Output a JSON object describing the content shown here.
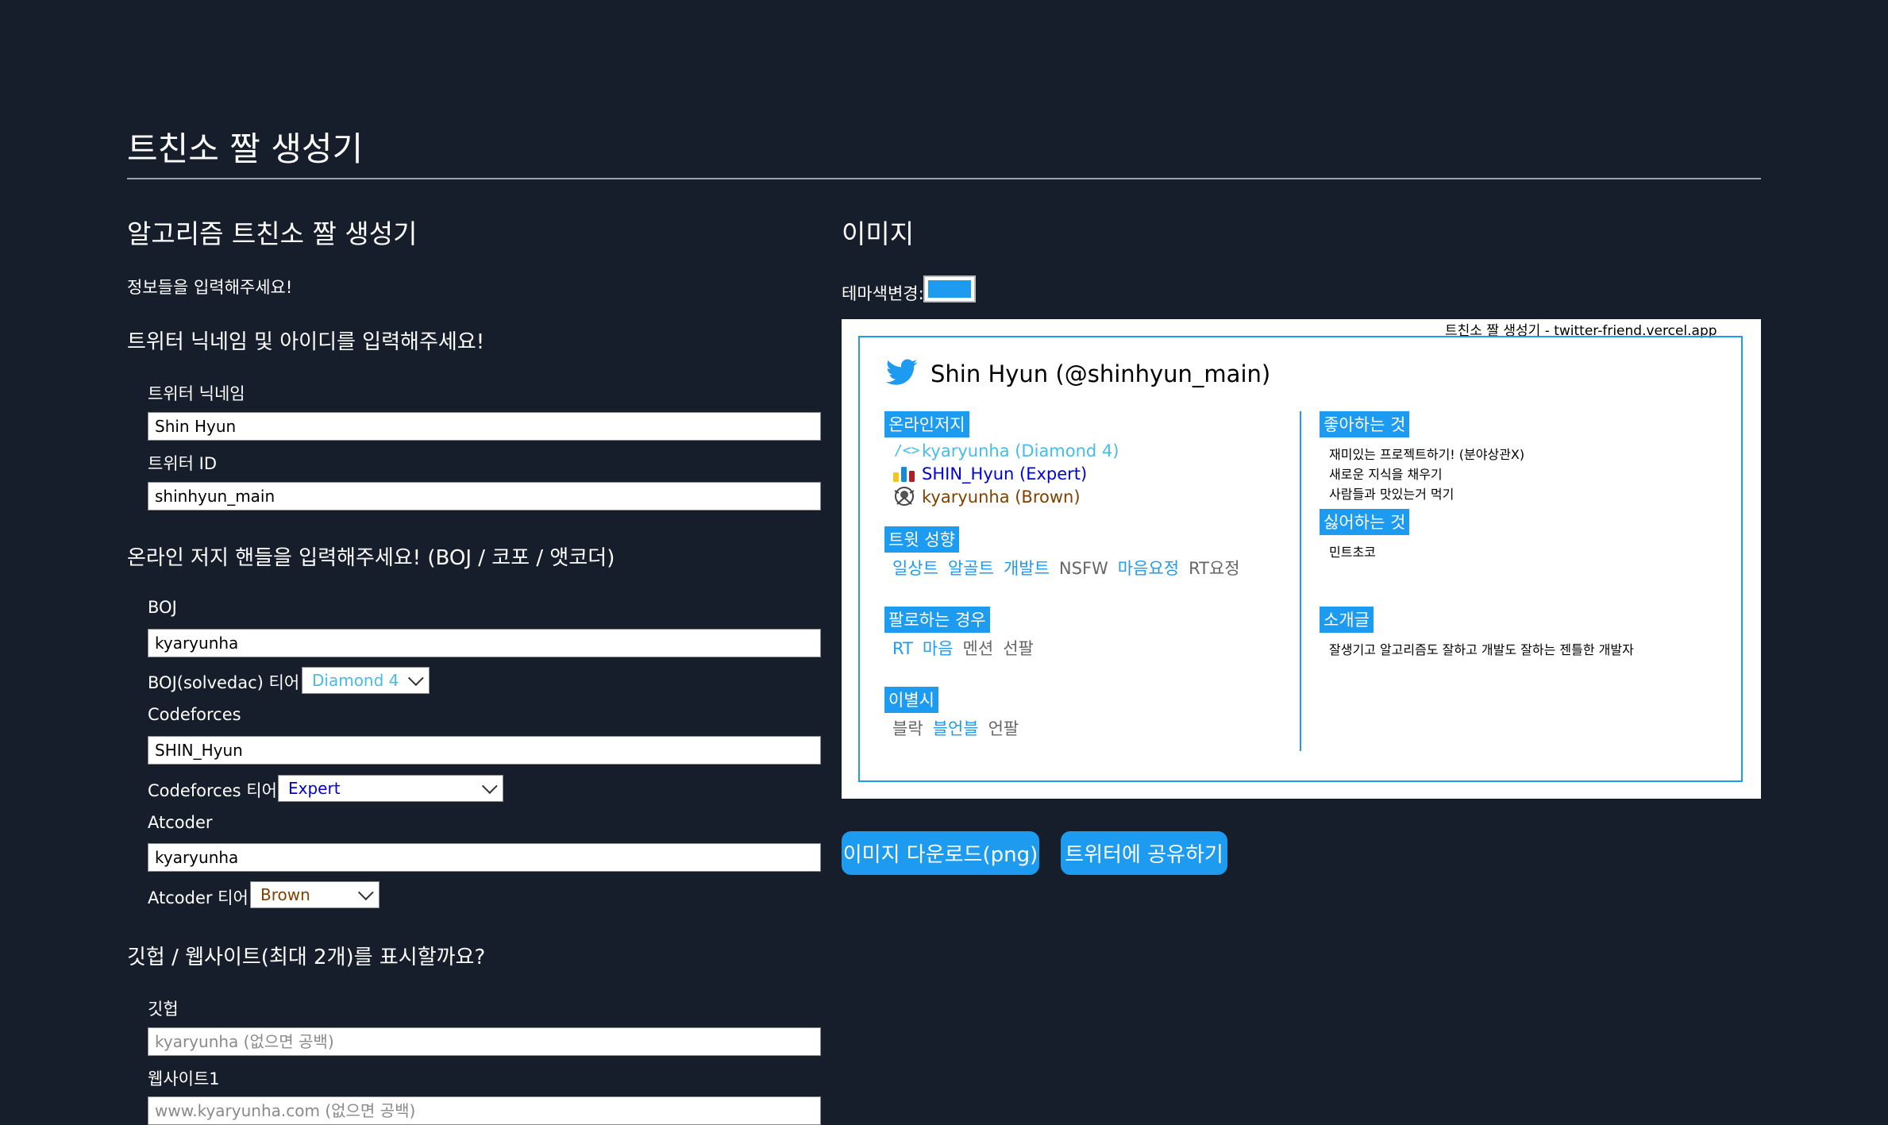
{
  "header": {
    "title": "트친소 짤 생성기"
  },
  "form": {
    "heading": "알고리즘 트친소 짤 생성기",
    "intro": "정보들을 입력해주세요!",
    "twitter": {
      "heading": "트위터 닉네임 및 아이디를 입력해주세요!",
      "nickname_label": "트위터 닉네임",
      "nickname_value": "Shin Hyun",
      "id_label": "트위터 ID",
      "id_value": "shinhyun_main"
    },
    "oj": {
      "heading": "온라인 저지 핸들을 입력해주세요! (BOJ / 코포 / 앳코더)",
      "boj_label": "BOJ",
      "boj_value": "kyaryunha",
      "boj_tier_label": "BOJ(solvedac) 티어",
      "boj_tier_value": "Diamond 4",
      "cf_label": "Codeforces",
      "cf_value": "SHIN_Hyun",
      "cf_tier_label": "Codeforces 티어",
      "cf_tier_value": "Expert",
      "ac_label": "Atcoder",
      "ac_value": "kyaryunha",
      "ac_tier_label": "Atcoder 티어",
      "ac_tier_value": "Brown"
    },
    "links": {
      "heading": "깃헙 / 웹사이트(최대 2개)를 표시할까요?",
      "github_label": "깃헙",
      "github_placeholder": "kyaryunha (없으면 공백)",
      "website1_label": "웹사이트1",
      "website1_placeholder": "www.kyaryunha.com (없으면 공백)"
    }
  },
  "image": {
    "heading": "이미지",
    "theme_label": "테마색변경:",
    "theme_color": "#1d9bf0",
    "watermark": "트친소 짤 생성기 - twitter-friend.vercel.app",
    "name": "Shin Hyun (@shinhyun_main)",
    "oj_tag": "온라인저지",
    "oj_rows": [
      {
        "icon": "solvedac-icon",
        "text": "kyaryunha (Diamond 4)",
        "color": "#45bde8"
      },
      {
        "icon": "codeforces-icon",
        "text": "SHIN_Hyun (Expert)",
        "color": "#0000dd"
      },
      {
        "icon": "atcoder-icon",
        "text": "kyaryunha (Brown)",
        "color": "#804000"
      }
    ],
    "tweet_tag": "트윗 성향",
    "tweet_items": [
      {
        "text": "일상트",
        "active": true
      },
      {
        "text": "알골트",
        "active": true
      },
      {
        "text": "개발트",
        "active": true
      },
      {
        "text": "NSFW",
        "active": false
      },
      {
        "text": "마음요정",
        "active": true
      },
      {
        "text": "RT요정",
        "active": false
      }
    ],
    "follow_tag": "팔로하는 경우",
    "follow_items": [
      {
        "text": "RT",
        "active": true
      },
      {
        "text": "마음",
        "active": true
      },
      {
        "text": "멘션",
        "active": false
      },
      {
        "text": "선팔",
        "active": false
      }
    ],
    "unfollow_tag": "이별시",
    "unfollow_items": [
      {
        "text": "블락",
        "active": false
      },
      {
        "text": "블언블",
        "active": true
      },
      {
        "text": "언팔",
        "active": false
      }
    ],
    "likes_tag": "좋아하는 것",
    "likes": [
      "재미있는 프로젝트하기! (분야상관X)",
      "새로운 지식을 채우기",
      "사람들과 맛있는거 먹기"
    ],
    "dislikes_tag": "싫어하는 것",
    "dislikes": [
      "민트초코"
    ],
    "intro_tag": "소개글",
    "intro_text": "잘생기고 알고리즘도 잘하고 개발도 잘하는 젠틀한 개발자"
  },
  "actions": {
    "download_label": "이미지 다운로드(png)",
    "share_label": "트위터에 공유하기"
  }
}
